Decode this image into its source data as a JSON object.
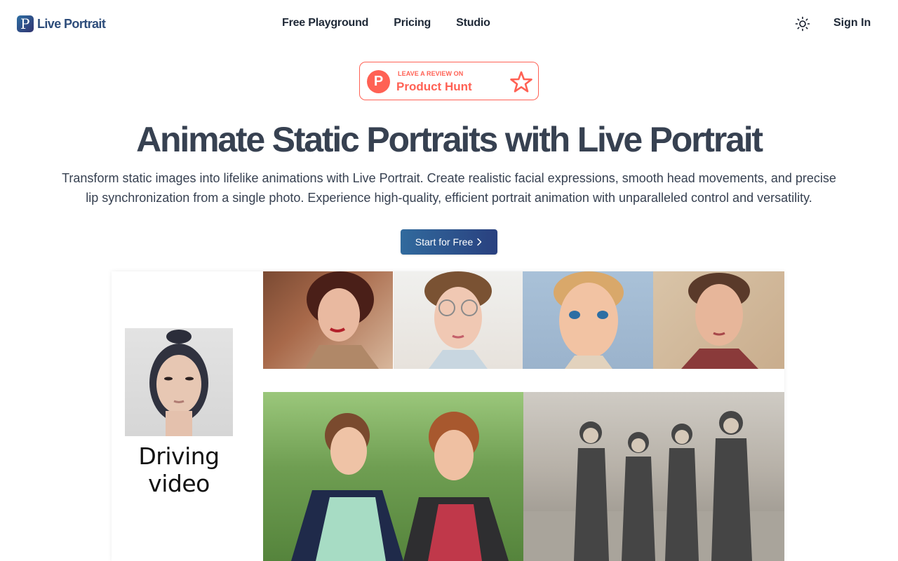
{
  "header": {
    "logo_mark": "P",
    "logo_text": "Live Portrait",
    "nav": [
      "Free Playground",
      "Pricing",
      "Studio"
    ],
    "theme_icon": "sun-icon",
    "signin_label": "Sign In"
  },
  "producthunt": {
    "small_text": "LEAVE A REVIEW ON",
    "big_text": "Product Hunt",
    "logo_letter": "P",
    "icon": "star-outline-icon",
    "color": "#ff6154"
  },
  "hero": {
    "title": "Animate Static Portraits with Live Portrait",
    "subtitle_line1": "Transform static images into lifelike animations with Live Portrait. Create realistic facial expressions, smooth head movements, and precise",
    "subtitle_line2": "lip synchronization from a single photo. Experience high-quality, efficient portrait animation with unparalleled control and versatility.",
    "cta_label": "Start for Free",
    "cta_icon": "chevron-right-icon"
  },
  "showcase": {
    "driving_label": "Driving video"
  },
  "colors": {
    "accent_start": "#316a9d",
    "accent_end": "#29407f",
    "heading": "#374151"
  }
}
